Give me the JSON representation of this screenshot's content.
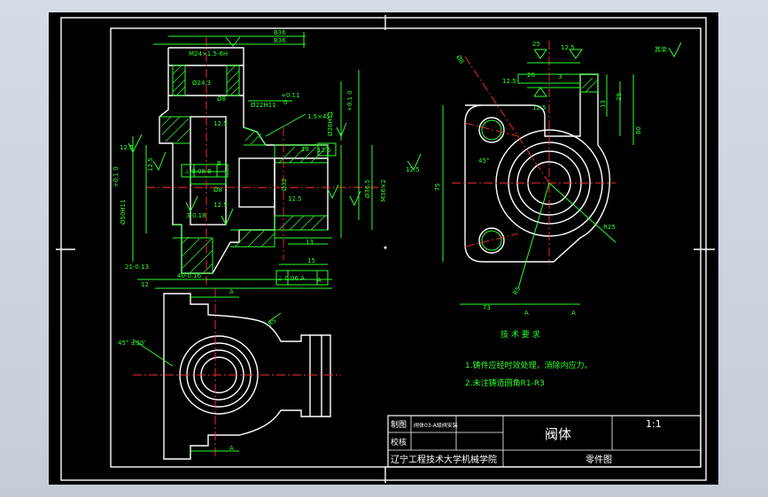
{
  "dims": {
    "b36_top": "B36",
    "b36_second": "B36",
    "d24": "Ø24.3",
    "m24": "M24×1.5-6H",
    "d22h11": "Ø22H11",
    "d22h11_tol_upper": "+0.11",
    "d22h11_tol_lower": "0",
    "chamfer": "1.5×45°",
    "d36h11": "Ø36H11",
    "d36h11_tol": "+0.1 0",
    "d50h11": "Ø50H11",
    "d50h11_tol": "+0.1 0",
    "ra125_a": "12.5",
    "ra125_b": "12.5",
    "ra125_c": "12.5",
    "ra125_d": "12.5",
    "ra125_e": "12.5",
    "ra125_f": "12.5",
    "ra125_g": "12.5",
    "ra125_h": "12.5",
    "ra125_i": "12.5",
    "perp1": "⊥ 0.08 B",
    "perp2": "⊥ 0.06 A",
    "d32": "Ø32",
    "d36_5": "Ø36.5",
    "m36": "M36×2",
    "d8": "Ø8",
    "b": "B",
    "a": "A",
    "tol_3": "3-0.18",
    "d21": "21-0.13",
    "d12": "12",
    "d40": "40-0.16",
    "d13": "13",
    "d15": "15",
    "d18": "18",
    "d8_top": "Ø8",
    "d25": "25",
    "d20": "20",
    "d12_5_top": "12.5",
    "d3": "3",
    "d29": "29",
    "d13_r": "13",
    "d80": "80",
    "d75": "75",
    "r25": "R25",
    "d8_hole": "Ø8",
    "d45deg": "45°",
    "d73": "73",
    "r5": "R5",
    "ang45": "45° ±30'",
    "section_a_top": "A",
    "section_a_bottom": "A",
    "section_a_top_r": "A",
    "section_a_bottom_r": "A",
    "others": "其余"
  },
  "notes": {
    "title": "技 术 要 求",
    "line1": "1.铸件应经时效处理，消除内应力。",
    "line2": "2.未注铸造圆角R1-R3"
  },
  "titleblock": {
    "drawn_label": "制图",
    "drawn_value": "阀体03-A级阀安装",
    "check_label": "校核",
    "part_name": "阀体",
    "scale": "1:1",
    "school": "辽宁工程技术大学机械学院",
    "drawing_type": "零件图"
  }
}
